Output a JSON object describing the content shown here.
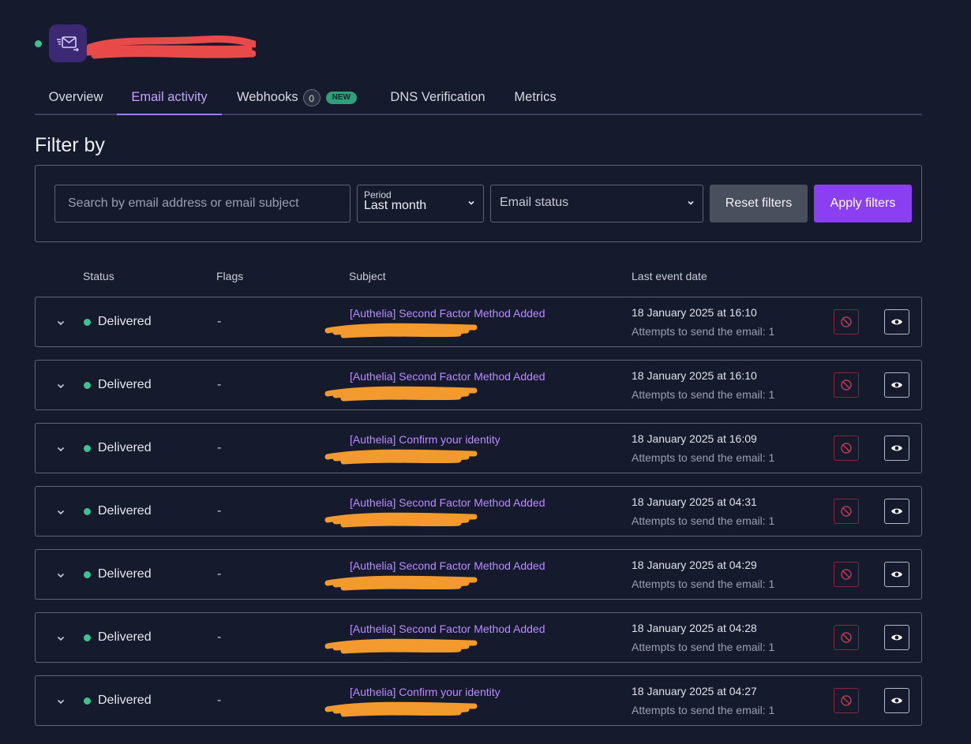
{
  "colors": {
    "background": "#151a2d",
    "accent": "#a57bff",
    "subject": "#b98cff",
    "delivered": "#3ec28f",
    "apply": "#8a3ff0",
    "danger": "#7d2a3e"
  },
  "header": {
    "icon": "email-forward-icon",
    "status": "online"
  },
  "tabs": [
    {
      "label": "Overview",
      "active": false
    },
    {
      "label": "Email activity",
      "active": true
    },
    {
      "label": "Webhooks",
      "count": "0",
      "badge": "NEW",
      "active": false
    },
    {
      "label": "DNS Verification",
      "active": false
    },
    {
      "label": "Metrics",
      "active": false
    }
  ],
  "filter": {
    "title": "Filter by",
    "search_placeholder": "Search by email address or email subject",
    "period_label": "Period",
    "period_value": "Last month",
    "status_placeholder": "Email status",
    "reset_label": "Reset filters",
    "apply_label": "Apply filters"
  },
  "columns": {
    "status": "Status",
    "flags": "Flags",
    "subject": "Subject",
    "last_event": "Last event date"
  },
  "rows": [
    {
      "status": "Delivered",
      "flags": "-",
      "subject": "[Authelia] Second Factor Method Added",
      "date": "18 January 2025 at 16:10",
      "attempts": "Attempts to send the email: 1"
    },
    {
      "status": "Delivered",
      "flags": "-",
      "subject": "[Authelia] Second Factor Method Added",
      "date": "18 January 2025 at 16:10",
      "attempts": "Attempts to send the email: 1"
    },
    {
      "status": "Delivered",
      "flags": "-",
      "subject": "[Authelia] Confirm your identity",
      "date": "18 January 2025 at 16:09",
      "attempts": "Attempts to send the email: 1"
    },
    {
      "status": "Delivered",
      "flags": "-",
      "subject": "[Authelia] Second Factor Method Added",
      "date": "18 January 2025 at 04:31",
      "attempts": "Attempts to send the email: 1"
    },
    {
      "status": "Delivered",
      "flags": "-",
      "subject": "[Authelia] Second Factor Method Added",
      "date": "18 January 2025 at 04:29",
      "attempts": "Attempts to send the email: 1"
    },
    {
      "status": "Delivered",
      "flags": "-",
      "subject": "[Authelia] Second Factor Method Added",
      "date": "18 January 2025 at 04:28",
      "attempts": "Attempts to send the email: 1"
    },
    {
      "status": "Delivered",
      "flags": "-",
      "subject": "[Authelia] Confirm your identity",
      "date": "18 January 2025 at 04:27",
      "attempts": "Attempts to send the email: 1"
    }
  ]
}
